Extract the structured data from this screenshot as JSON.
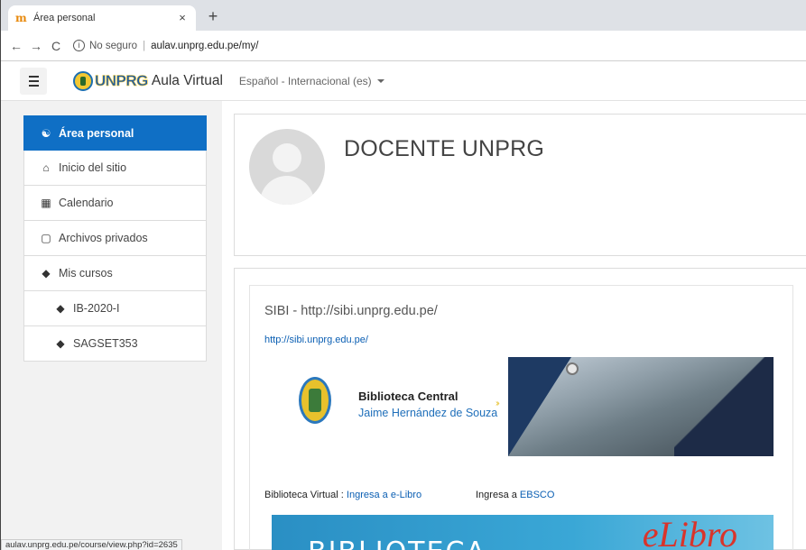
{
  "browser": {
    "tab_title": "Área personal",
    "tab_favicon": "m",
    "close_glyph": "×",
    "new_tab_glyph": "+",
    "back_glyph": "←",
    "forward_glyph": "→",
    "reload_glyph": "C",
    "info_glyph": "i",
    "security_label": "No seguro",
    "separator": "|",
    "url": "aulav.unprg.edu.pe/my/",
    "status_url": "aulav.unprg.edu.pe/course/view.php?id=2635"
  },
  "navbar": {
    "logo_text": "UNPRG",
    "site_name": "Aula Virtual",
    "language": "Español - Internacional (es)"
  },
  "sidebar": {
    "items": [
      {
        "label": "Área personal",
        "icon": "dashboard-icon",
        "glyph": "☯"
      },
      {
        "label": "Inicio del sitio",
        "icon": "home-icon",
        "glyph": "⌂"
      },
      {
        "label": "Calendario",
        "icon": "calendar-icon",
        "glyph": "▦"
      },
      {
        "label": "Archivos privados",
        "icon": "file-icon",
        "glyph": "▢"
      },
      {
        "label": "Mis cursos",
        "icon": "graduation-cap-icon",
        "glyph": "◆"
      },
      {
        "label": "IB-2020-I",
        "icon": "graduation-cap-icon",
        "glyph": "◆"
      },
      {
        "label": "SAGSET353",
        "icon": "graduation-cap-icon",
        "glyph": "◆"
      }
    ],
    "active_color": "#0f6fc5"
  },
  "profile": {
    "name": "DOCENTE UNPRG"
  },
  "block": {
    "title": "SIBI - http://sibi.unprg.edu.pe/",
    "link": "http://sibi.unprg.edu.pe/",
    "banner_title": "Biblioteca Central",
    "banner_subtitle": "Jaime Hernández de Souza",
    "banner_arrows": "››",
    "ebook_prefix": "Biblioteca Virtual : ",
    "ebook_link": "Ingresa a e-Libro",
    "ebsco_prefix": "Ingresa a ",
    "ebsco_link": "EBSCO",
    "elibro_text": "BIBLIOTECA",
    "elibro_brand": "eLibro"
  }
}
